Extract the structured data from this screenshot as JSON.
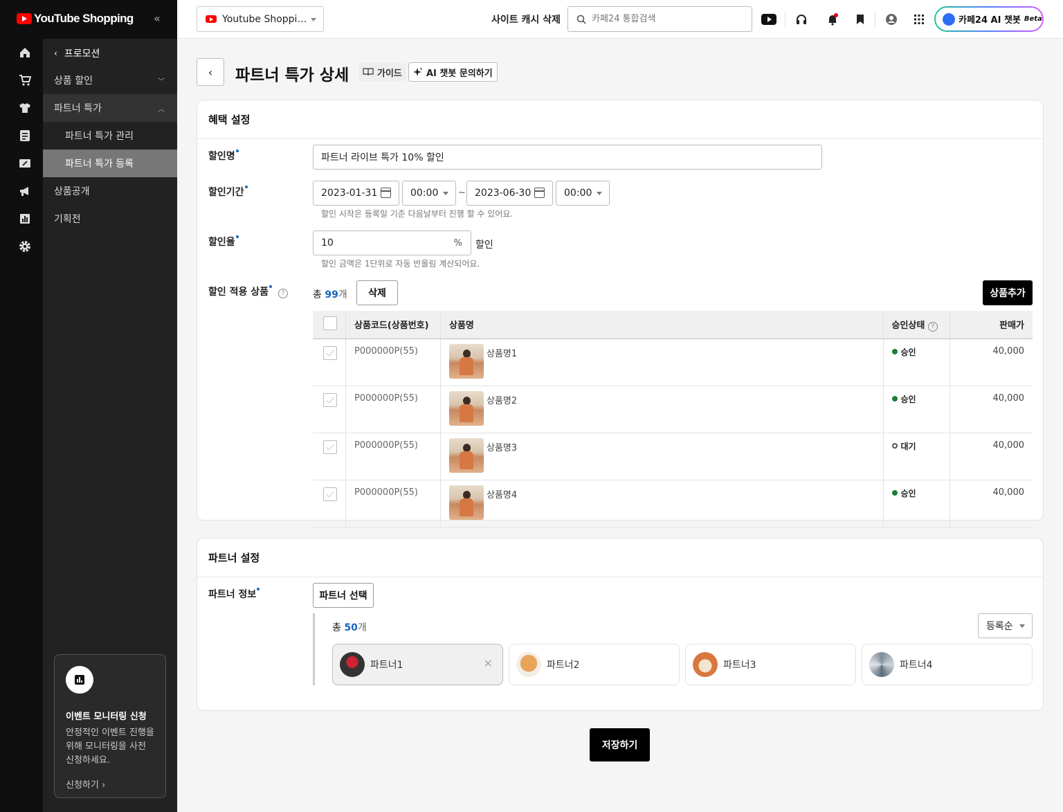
{
  "brand": {
    "name": "YouTube Shopping",
    "collapse_icon": "double-chevron-left-icon"
  },
  "rail": {
    "icons": [
      "home-icon",
      "cart-icon",
      "shirt-icon",
      "document-icon",
      "coupon-icon",
      "megaphone-icon",
      "chart-icon",
      "gear-icon"
    ]
  },
  "submenu": {
    "back_label": "프로모션",
    "items": [
      {
        "label": "상품 할인"
      },
      {
        "label": "파트너 특가"
      },
      {
        "label": "파트너 특가 관리"
      },
      {
        "label": "파트너 특가 등록"
      },
      {
        "label": "상품공개"
      },
      {
        "label": "기획전"
      }
    ],
    "monitor": {
      "title": "이벤트 모니터링 신청",
      "desc": "안정적인 이벤트 진행을 위해 모니터링을 사전 신청하세요.",
      "link": "신청하기 ›"
    }
  },
  "topbar": {
    "shop_select": "Youtube Shoppi…",
    "cache_label": "사이트 캐시 삭제",
    "search_placeholder": "카페24 통합검색",
    "ai_label": "카페24 AI 챗봇",
    "ai_beta": "Beta"
  },
  "header": {
    "title": "파트너 특가 상세",
    "guide": "가이드",
    "ai_ask": "AI 챗봇 문의하기"
  },
  "benefit": {
    "title": "혜택 설정",
    "name_label": "할인명",
    "name_value": "파트너 라이브 특가 10% 할인",
    "period_label": "할인기간",
    "start_date": "2023-01-31",
    "start_time": "00:00",
    "tilde": "~",
    "end_date": "2023-06-30",
    "end_time": "00:00",
    "period_hint": "할인 시작은 등록일 기준 다음날부터 진행 할 수 있어요.",
    "rate_label": "할인율",
    "rate_value": "10",
    "rate_unit": "%",
    "rate_suffix": "할인",
    "rate_hint": "할인 금액은 1단위로 자동 반올림 계산되어요.",
    "products_label": "할인 적용 상품",
    "total_prefix": "총",
    "total_count": "99",
    "total_suffix": "개",
    "delete_btn": "삭제",
    "add_btn": "상품추가",
    "columns": [
      "상품코드(상품번호)",
      "상품명",
      "승인상태",
      "판매가"
    ],
    "rows": [
      {
        "code": "P000000P(55)",
        "name": "상품명1",
        "status": "승인",
        "price": "40,000"
      },
      {
        "code": "P000000P(55)",
        "name": "상품명2",
        "status": "승인",
        "price": "40,000"
      },
      {
        "code": "P000000P(55)",
        "name": "상품명3",
        "status": "대기",
        "price": "40,000"
      },
      {
        "code": "P000000P(55)",
        "name": "상품명4",
        "status": "승인",
        "price": "40,000"
      }
    ]
  },
  "partner": {
    "title": "파트너 설정",
    "info_label": "파트너 정보",
    "select_btn": "파트너 선택",
    "total_prefix": "총",
    "total_count": "50",
    "total_suffix": "개",
    "sort_label": "등록순",
    "partners": [
      {
        "name": "파트너1",
        "color": "#2c3e50"
      },
      {
        "name": "파트너2",
        "color": "#e8a45a"
      },
      {
        "name": "파트너3",
        "color": "#d9773f"
      },
      {
        "name": "파트너4",
        "color": "#7f8c99"
      }
    ]
  },
  "save_btn": "저장하기"
}
